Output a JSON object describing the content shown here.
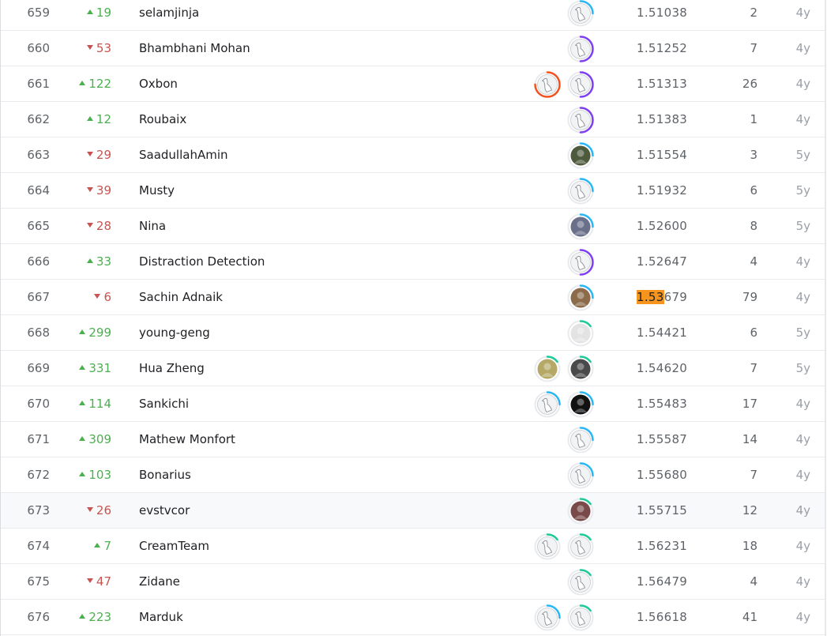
{
  "rows": [
    {
      "rank": "659",
      "trend": "up",
      "delta": "19",
      "team": "selamjinja",
      "score": "1.51038",
      "entries": "2",
      "last": "4y",
      "avatars": [
        {
          "ring": "#29b6f6",
          "pct": 0.25,
          "kind": "default"
        }
      ]
    },
    {
      "rank": "660",
      "trend": "down",
      "delta": "53",
      "team": "Bhambhani Mohan",
      "score": "1.51252",
      "entries": "7",
      "last": "4y",
      "avatars": [
        {
          "ring": "#7e3ff2",
          "pct": 0.5,
          "kind": "default"
        }
      ]
    },
    {
      "rank": "661",
      "trend": "up",
      "delta": "122",
      "team": "Oxbon",
      "score": "1.51313",
      "entries": "26",
      "last": "4y",
      "avatars": [
        {
          "ring": "#f4511e",
          "pct": 0.75,
          "kind": "default"
        },
        {
          "ring": "#7e3ff2",
          "pct": 0.5,
          "kind": "default"
        }
      ]
    },
    {
      "rank": "662",
      "trend": "up",
      "delta": "12",
      "team": "Roubaix",
      "score": "1.51383",
      "entries": "1",
      "last": "4y",
      "avatars": [
        {
          "ring": "#7e3ff2",
          "pct": 0.5,
          "kind": "default"
        }
      ]
    },
    {
      "rank": "663",
      "trend": "down",
      "delta": "29",
      "team": "SaadullahAmin",
      "score": "1.51554",
      "entries": "3",
      "last": "5y",
      "avatars": [
        {
          "ring": "#29b6f6",
          "pct": 0.25,
          "kind": "photo",
          "bg": "#4e5a3c"
        }
      ]
    },
    {
      "rank": "664",
      "trend": "down",
      "delta": "39",
      "team": "Musty",
      "score": "1.51932",
      "entries": "6",
      "last": "5y",
      "avatars": [
        {
          "ring": "#29b6f6",
          "pct": 0.25,
          "kind": "default"
        }
      ]
    },
    {
      "rank": "665",
      "trend": "down",
      "delta": "28",
      "team": "Nina",
      "score": "1.52600",
      "entries": "8",
      "last": "5y",
      "avatars": [
        {
          "ring": "#29b6f6",
          "pct": 0.25,
          "kind": "photo",
          "bg": "#6a6f8a"
        }
      ]
    },
    {
      "rank": "666",
      "trend": "up",
      "delta": "33",
      "team": "Distraction Detection",
      "score": "1.52647",
      "entries": "4",
      "last": "4y",
      "avatars": [
        {
          "ring": "#7e3ff2",
          "pct": 0.5,
          "kind": "default"
        }
      ]
    },
    {
      "rank": "667",
      "trend": "down",
      "delta": "6",
      "team": "Sachin Adnaik",
      "score_highlight": "1.53",
      "score_rest": "679",
      "entries": "79",
      "last": "4y",
      "avatars": [
        {
          "ring": "#29b6f6",
          "pct": 0.25,
          "kind": "photo",
          "bg": "#8b6b4a"
        }
      ]
    },
    {
      "rank": "668",
      "trend": "up",
      "delta": "299",
      "team": "young-geng",
      "score": "1.54421",
      "entries": "6",
      "last": "5y",
      "avatars": [
        {
          "ring": "#20c997",
          "pct": 0.15,
          "kind": "photo",
          "bg": "#e3e3e3"
        }
      ]
    },
    {
      "rank": "669",
      "trend": "up",
      "delta": "331",
      "team": "Hua Zheng",
      "score": "1.54620",
      "entries": "7",
      "last": "5y",
      "avatars": [
        {
          "ring": "#20c997",
          "pct": 0.15,
          "kind": "photo",
          "bg": "#b6a968"
        },
        {
          "ring": "#20c997",
          "pct": 0.15,
          "kind": "photo",
          "bg": "#4a4a4a"
        }
      ]
    },
    {
      "rank": "670",
      "trend": "up",
      "delta": "114",
      "team": "Sankichi",
      "score": "1.55483",
      "entries": "17",
      "last": "4y",
      "avatars": [
        {
          "ring": "#29b6f6",
          "pct": 0.25,
          "kind": "default"
        },
        {
          "ring": "#29b6f6",
          "pct": 0.25,
          "kind": "photo",
          "bg": "#111111"
        }
      ]
    },
    {
      "rank": "671",
      "trend": "up",
      "delta": "309",
      "team": "Mathew Monfort",
      "score": "1.55587",
      "entries": "14",
      "last": "4y",
      "avatars": [
        {
          "ring": "#29b6f6",
          "pct": 0.25,
          "kind": "default"
        }
      ]
    },
    {
      "rank": "672",
      "trend": "up",
      "delta": "103",
      "team": "Bonarius",
      "score": "1.55680",
      "entries": "7",
      "last": "4y",
      "avatars": [
        {
          "ring": "#29b6f6",
          "pct": 0.25,
          "kind": "default"
        }
      ]
    },
    {
      "rank": "673",
      "trend": "down",
      "delta": "26",
      "team": "evstvcor",
      "score": "1.55715",
      "entries": "12",
      "last": "4y",
      "hover": true,
      "avatars": [
        {
          "ring": "#20c997",
          "pct": 0.15,
          "kind": "photo",
          "bg": "#7a4a4a"
        }
      ]
    },
    {
      "rank": "674",
      "trend": "up",
      "delta": "7",
      "team": "CreamTeam",
      "score": "1.56231",
      "entries": "18",
      "last": "4y",
      "avatars": [
        {
          "ring": "#20c997",
          "pct": 0.15,
          "kind": "default"
        },
        {
          "ring": "#20c997",
          "pct": 0.15,
          "kind": "default"
        }
      ]
    },
    {
      "rank": "675",
      "trend": "down",
      "delta": "47",
      "team": "Zidane",
      "score": "1.56479",
      "entries": "4",
      "last": "4y",
      "avatars": [
        {
          "ring": "#20c997",
          "pct": 0.15,
          "kind": "default"
        }
      ]
    },
    {
      "rank": "676",
      "trend": "up",
      "delta": "223",
      "team": "Marduk",
      "score": "1.56618",
      "entries": "41",
      "last": "4y",
      "avatars": [
        {
          "ring": "#29b6f6",
          "pct": 0.25,
          "kind": "default"
        },
        {
          "ring": "#20c997",
          "pct": 0.15,
          "kind": "default"
        }
      ]
    }
  ]
}
